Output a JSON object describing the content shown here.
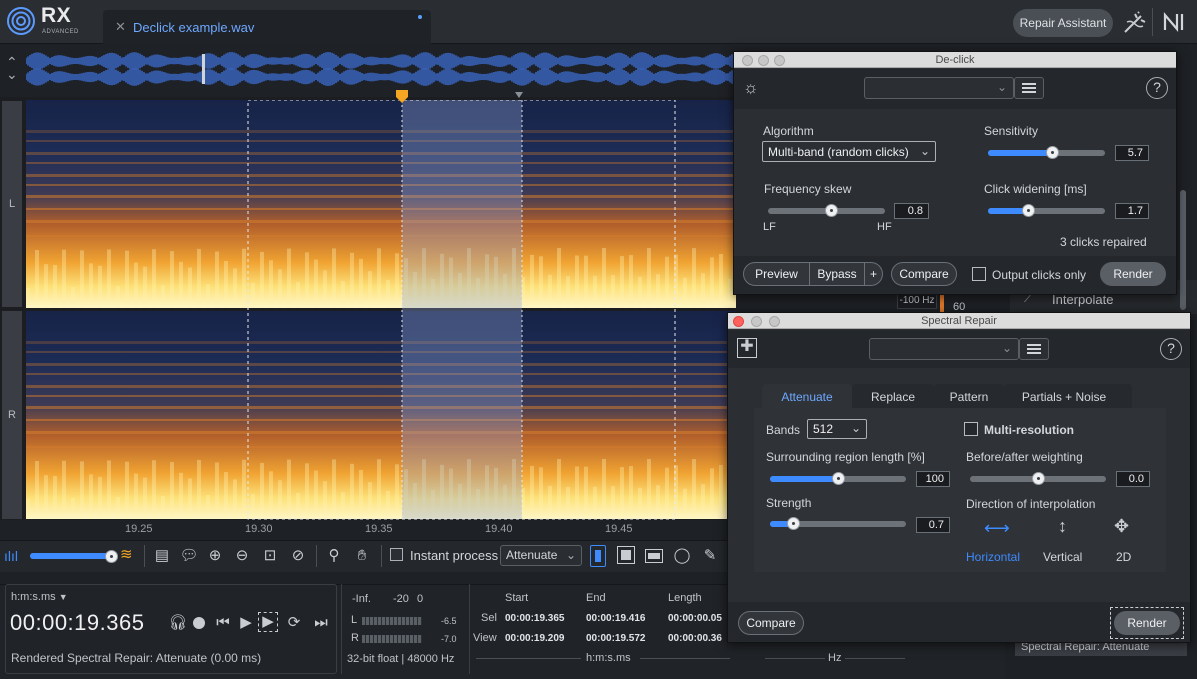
{
  "app": {
    "name": "RX",
    "edition": "ADVANCED",
    "repair_assistant": "Repair Assistant"
  },
  "file_tab": {
    "title": "Declick example.wav"
  },
  "channels": [
    "L",
    "R"
  ],
  "timeline": {
    "ticks": [
      "19.25",
      "19.30",
      "19.35",
      "19.40",
      "19.45"
    ]
  },
  "spectrogram": {
    "freq_label": "-100 Hz",
    "db_label": "60",
    "interpolate_text": "Interpolate"
  },
  "toolbar": {
    "instant_process": "Instant process",
    "mode_select": "Attenuate"
  },
  "transport": {
    "format": "h:m:s.ms",
    "timecode": "00:00:19.365",
    "status": "Rendered Spectral Repair: Attenuate (0.00 ms)",
    "meter_scale": [
      "-Inf.",
      "-20",
      "0"
    ],
    "meter_l": "L",
    "meter_r": "R",
    "meter_l_val": "-6.5",
    "meter_r_val": "-7.0",
    "bitrate": "32-bit float | 48000 Hz",
    "sel_headers": [
      "Start",
      "End",
      "Length"
    ],
    "sel_label": "Sel",
    "view_label": "View",
    "sel_values": [
      "00:00:19.365",
      "00:00:19.416",
      "00:00:00.05"
    ],
    "view_values": [
      "00:00:19.209",
      "00:00:19.572",
      "00:00:00.36"
    ],
    "units_hms": "h:m:s.ms",
    "units_hz": "Hz",
    "history_last": "Spectral Repair: Attenuate"
  },
  "declick": {
    "title": "De-click",
    "algorithm_label": "Algorithm",
    "algorithm_value": "Multi-band (random clicks)",
    "sensitivity_label": "Sensitivity",
    "sensitivity_value": "5.7",
    "sensitivity_level": 0.55,
    "freq_skew_label": "Frequency skew",
    "freq_skew_value": "0.8",
    "freq_skew_level": 0.54,
    "lf": "LF",
    "hf": "HF",
    "click_widening_label": "Click widening [ms]",
    "click_widening_value": "1.7",
    "click_widening_level": 0.34,
    "status": "3 clicks repaired",
    "preview": "Preview",
    "bypass": "Bypass",
    "plus": "+",
    "compare": "Compare",
    "output_clicks_only": "Output clicks only",
    "render": "Render"
  },
  "spectral_repair": {
    "title": "Spectral Repair",
    "tabs": [
      "Attenuate",
      "Replace",
      "Pattern",
      "Partials + Noise"
    ],
    "bands_label": "Bands",
    "bands_value": "512",
    "multi_resolution": "Multi-resolution",
    "surrounding_label": "Surrounding region length [%]",
    "surrounding_value": "100",
    "surrounding_level": 0.5,
    "before_after_label": "Before/after weighting",
    "before_after_value": "0.0",
    "before_after_level": 0.5,
    "strength_label": "Strength",
    "strength_value": "0.7",
    "strength_level": 0.17,
    "direction_label": "Direction of interpolation",
    "directions": [
      "Horizontal",
      "Vertical",
      "2D"
    ],
    "compare": "Compare",
    "render": "Render"
  },
  "colors": {
    "accent": "#3d8bff",
    "spectrogram_hot": "#f6b33a",
    "spectrogram_cold": "#1b2a55"
  }
}
